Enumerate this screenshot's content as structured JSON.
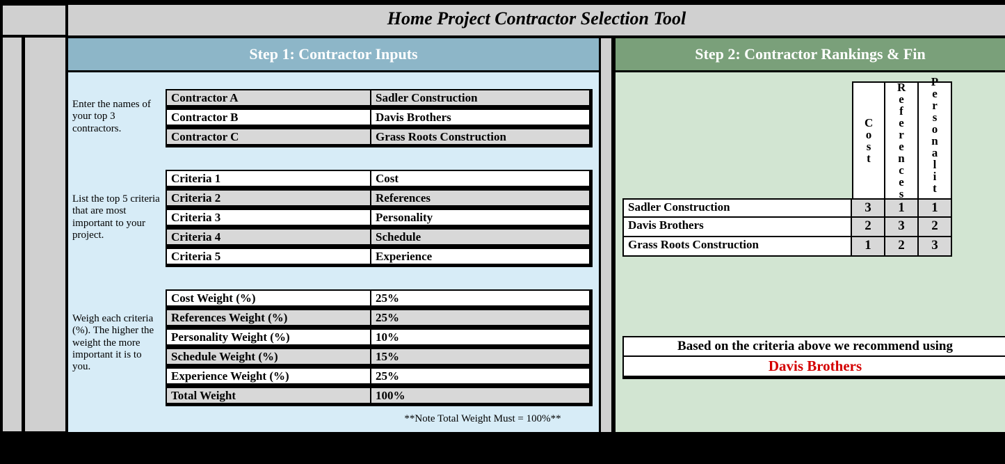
{
  "title": "Home Project Contractor Selection Tool",
  "step1": {
    "heading": "Step 1: Contractor Inputs",
    "instructions": {
      "contractors": "Enter the names of your top 3 contractors.",
      "criteria": "List the top 5 criteria that are most important to your project.",
      "weights": "Weigh each criteria (%).  The higher the weight the more important it is to you."
    },
    "contractors": [
      {
        "label": "Contractor A",
        "value": "Sadler Construction"
      },
      {
        "label": "Contractor B",
        "value": "Davis Brothers"
      },
      {
        "label": "Contractor C",
        "value": "Grass Roots Construction"
      }
    ],
    "criteria": [
      {
        "label": "Criteria 1",
        "value": "Cost"
      },
      {
        "label": "Criteria 2",
        "value": "References"
      },
      {
        "label": "Criteria 3",
        "value": "Personality"
      },
      {
        "label": "Criteria 4",
        "value": "Schedule"
      },
      {
        "label": "Criteria 5",
        "value": "Experience"
      }
    ],
    "weights": [
      {
        "label": "Cost Weight (%)",
        "value": "25%"
      },
      {
        "label": "References Weight (%)",
        "value": "25%"
      },
      {
        "label": "Personality Weight (%)",
        "value": "10%"
      },
      {
        "label": "Schedule Weight (%)",
        "value": "15%"
      },
      {
        "label": "Experience Weight (%)",
        "value": "25%"
      },
      {
        "label": "Total Weight",
        "value": "100%"
      }
    ],
    "weight_note": "**Note Total Weight Must = 100%**"
  },
  "step2": {
    "heading": "Step 2: Contractor Rankings & Fin",
    "columns": [
      "Cost",
      "References",
      "Personality"
    ],
    "rows": [
      {
        "name": "Sadler Construction",
        "scores": [
          "3",
          "1",
          "1"
        ]
      },
      {
        "name": "Davis Brothers",
        "scores": [
          "2",
          "3",
          "2"
        ]
      },
      {
        "name": "Grass Roots Construction",
        "scores": [
          "1",
          "2",
          "3"
        ]
      }
    ],
    "recommendation_text": "Based on the criteria above we recommend using",
    "recommendation_name": "Davis Brothers"
  }
}
